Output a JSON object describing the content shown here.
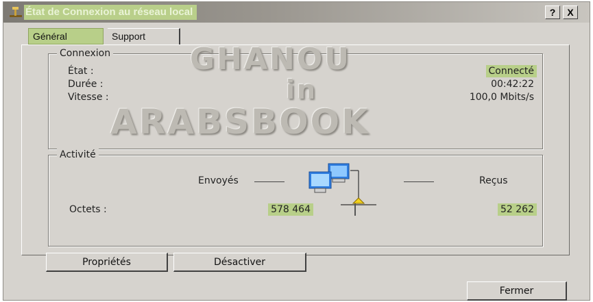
{
  "window": {
    "title": "État de Connexion au réseau local",
    "help_button": "?",
    "close_button": "X"
  },
  "tabs": [
    {
      "label": "Général",
      "active": true
    },
    {
      "label": "Support",
      "active": false
    }
  ],
  "connexion": {
    "group_title": "Connexion",
    "rows": [
      {
        "label": "État :",
        "value": "Connecté"
      },
      {
        "label": "Durée :",
        "value": "00:42:22"
      },
      {
        "label": "Vitesse :",
        "value": "100,0 Mbits/s"
      }
    ]
  },
  "watermark": {
    "line1": "GHANOU",
    "line2": "in",
    "line3": "ARABSBOOK"
  },
  "activite": {
    "group_title": "Activité",
    "sent_label": "Envoyés",
    "received_label": "Reçus",
    "bytes_label": "Octets :",
    "bytes_sent": "578 464",
    "bytes_received": "52 262",
    "network_icon": "network-computers-icon"
  },
  "buttons": {
    "properties": "Propriétés",
    "disable": "Désactiver",
    "close": "Fermer"
  },
  "colors": {
    "highlight": "#b8cf89",
    "dialog_bg": "#d6d3ce"
  }
}
